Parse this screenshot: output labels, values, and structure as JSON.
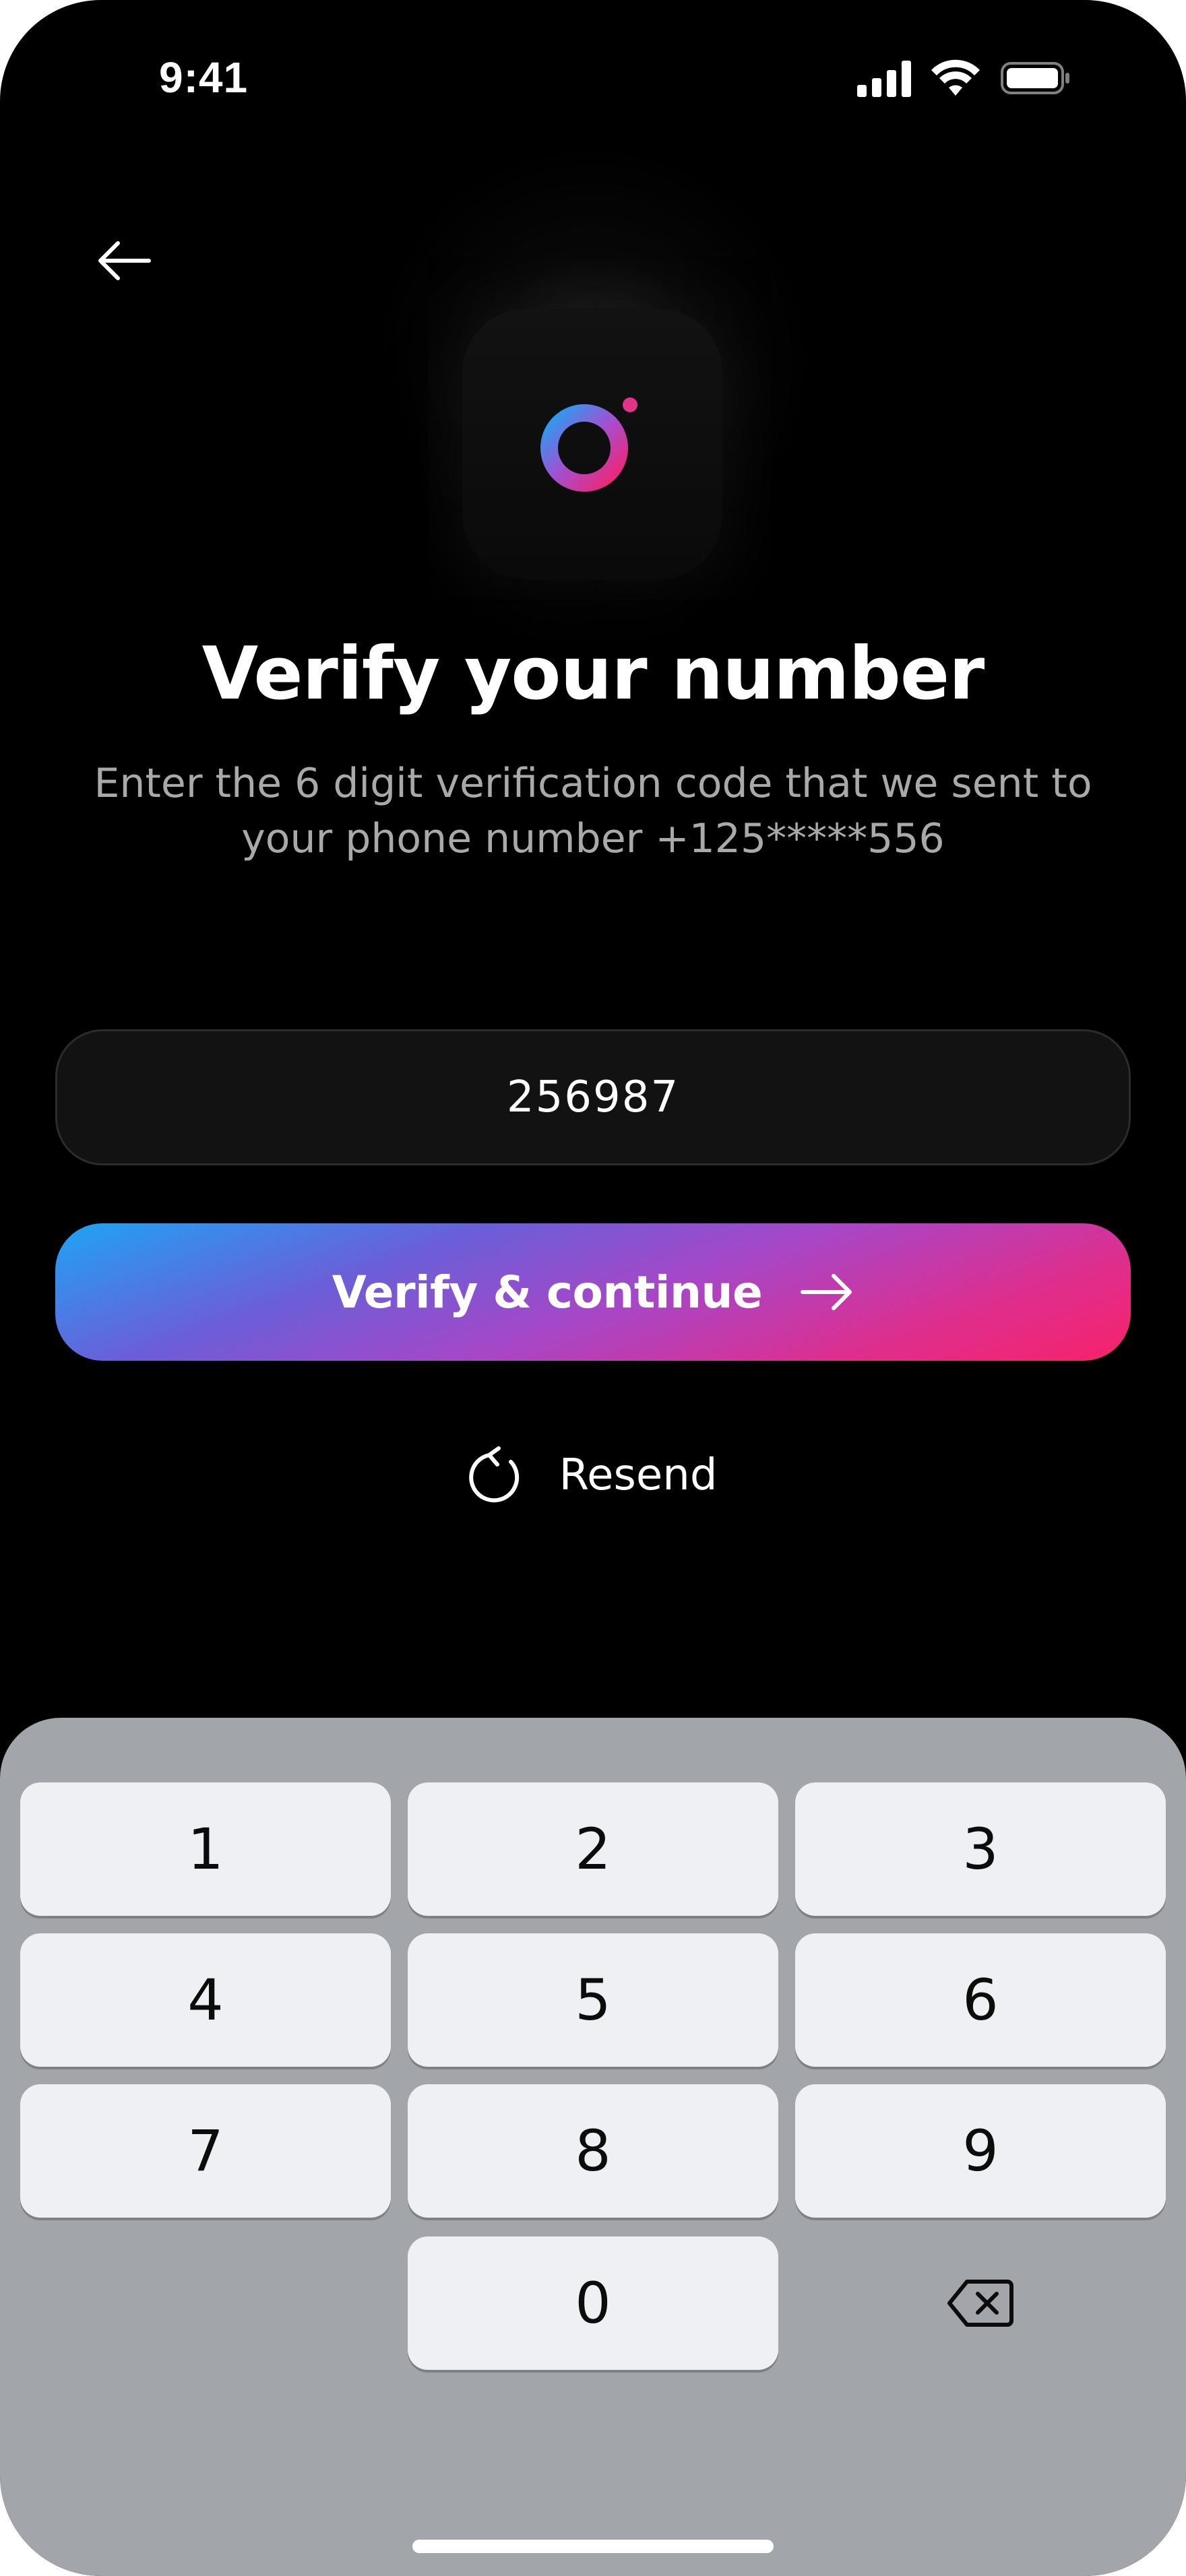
{
  "status_bar": {
    "time": "9:41"
  },
  "header": {
    "back_icon": "arrow-left-icon"
  },
  "logo": {
    "icon": "app-logo-a",
    "gradient": [
      "#1ea4f4",
      "#9a4fd0",
      "#f7226b"
    ]
  },
  "title": "Verify your number",
  "subtitle": "Enter the 6 digit verification code that we sent to\nyour phone number +125*****556",
  "code_input": {
    "value": "256987"
  },
  "verify_button": {
    "label": "Verify & continue",
    "icon": "arrow-right-icon",
    "gradient": [
      "#1ea4f4",
      "#a846c6",
      "#f7226b"
    ]
  },
  "resend": {
    "label": "Resend",
    "icon": "refresh-icon"
  },
  "keypad": {
    "keys": [
      "1",
      "2",
      "3",
      "4",
      "5",
      "6",
      "7",
      "8",
      "9",
      "0"
    ],
    "delete_icon": "backspace-icon"
  },
  "colors": {
    "background": "#000000",
    "subtitle_text": "#a9a9a9",
    "input_background": "#121212",
    "keyboard_background": "#a2a5aa",
    "key_background": "#eef0f4"
  }
}
